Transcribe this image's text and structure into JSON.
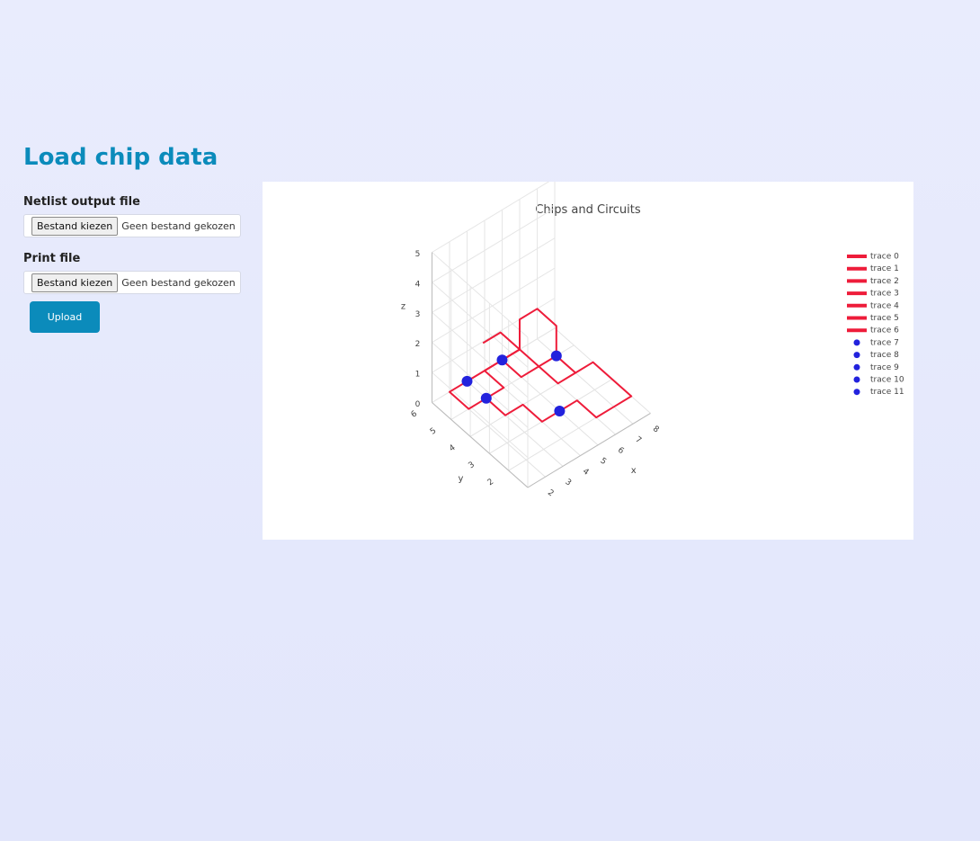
{
  "page": {
    "title": "Load chip data",
    "netlist_label": "Netlist output file",
    "print_label": "Print file",
    "choose_button": "Bestand kiezen",
    "no_file": "Geen bestand gekozen",
    "upload_button": "Upload"
  },
  "colors": {
    "accent": "#0b8bbb",
    "wire": "#ee1c3a",
    "gate": "#2222dd"
  },
  "chart_data": {
    "type": "scatter3d",
    "title": "Chips and Circuits",
    "xlabel": "x",
    "ylabel": "y",
    "zlabel": "z",
    "x_ticks": [
      "2",
      "3",
      "4",
      "5",
      "6",
      "7",
      "8"
    ],
    "y_ticks": [
      "2",
      "3",
      "4",
      "5",
      "6"
    ],
    "z_ticks": [
      "0",
      "1",
      "2",
      "3",
      "4",
      "5"
    ],
    "xlim": [
      1,
      8
    ],
    "ylim": [
      1,
      6
    ],
    "zlim": [
      0,
      5
    ],
    "grid": true,
    "legend_position": "right",
    "series": [
      {
        "name": "trace 0",
        "mode": "lines",
        "points": [
          [
            3,
            5,
            0
          ],
          [
            3,
            4,
            0
          ],
          [
            4,
            4,
            0
          ],
          [
            4,
            3,
            0
          ],
          [
            5,
            3,
            0
          ]
        ]
      },
      {
        "name": "trace 1",
        "mode": "lines",
        "points": [
          [
            3,
            5,
            0
          ],
          [
            4,
            5,
            0
          ],
          [
            4,
            6,
            0
          ],
          [
            5,
            6,
            0
          ],
          [
            5,
            5,
            0
          ],
          [
            6,
            5,
            0
          ],
          [
            6,
            4,
            0
          ],
          [
            7,
            4,
            0
          ],
          [
            7,
            5,
            0
          ]
        ]
      },
      {
        "name": "trace 2",
        "mode": "lines",
        "points": [
          [
            3,
            5,
            0
          ],
          [
            2,
            5,
            0
          ],
          [
            2,
            6,
            0
          ],
          [
            3,
            6,
            0
          ]
        ]
      },
      {
        "name": "trace 3",
        "mode": "lines",
        "points": [
          [
            5,
            3,
            0
          ],
          [
            6,
            3,
            0
          ],
          [
            6,
            2,
            0
          ],
          [
            7,
            2,
            0
          ],
          [
            8,
            2,
            0
          ],
          [
            8,
            3,
            0
          ],
          [
            8,
            4,
            0
          ],
          [
            7,
            4,
            0
          ]
        ]
      },
      {
        "name": "trace 4",
        "mode": "lines",
        "points": [
          [
            3,
            6,
            0
          ],
          [
            4,
            6,
            0
          ],
          [
            5,
            6,
            0
          ],
          [
            6,
            6,
            0
          ],
          [
            6,
            5,
            0
          ],
          [
            7,
            5,
            0
          ]
        ]
      },
      {
        "name": "trace 5",
        "mode": "lines",
        "points": [
          [
            7,
            5,
            0
          ],
          [
            7,
            5,
            1
          ],
          [
            7,
            6,
            1
          ],
          [
            6,
            6,
            1
          ],
          [
            6,
            6,
            0
          ],
          [
            5,
            6,
            0
          ]
        ]
      },
      {
        "name": "trace 6",
        "mode": "lines",
        "points": [
          [
            5,
            6,
            0
          ],
          [
            6,
            6,
            0
          ],
          [
            6,
            7,
            0
          ],
          [
            5,
            7,
            0
          ]
        ]
      },
      {
        "name": "trace 7",
        "mode": "markers",
        "points": [
          [
            3,
            5,
            0
          ]
        ]
      },
      {
        "name": "trace 8",
        "mode": "markers",
        "points": [
          [
            5,
            3,
            0
          ]
        ]
      },
      {
        "name": "trace 9",
        "mode": "markers",
        "points": [
          [
            5,
            6,
            0
          ]
        ]
      },
      {
        "name": "trace 10",
        "mode": "markers",
        "points": [
          [
            3,
            6,
            0
          ]
        ]
      },
      {
        "name": "trace 11",
        "mode": "markers",
        "points": [
          [
            7,
            5,
            0
          ]
        ]
      }
    ]
  }
}
